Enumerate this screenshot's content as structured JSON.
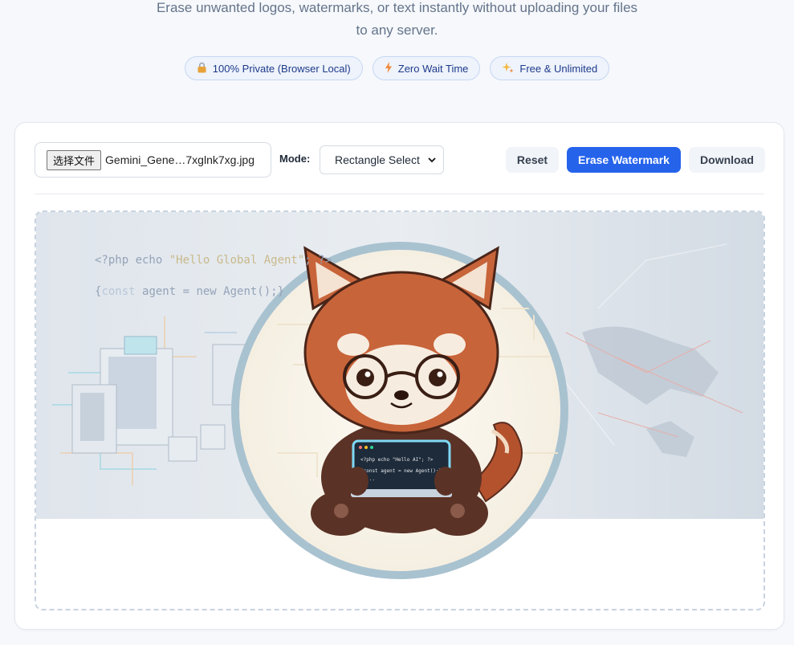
{
  "hero": {
    "subtitle_line1": "Erase unwanted logos, watermarks, or text instantly without uploading your files",
    "subtitle_line2": "to any server."
  },
  "badges": [
    {
      "icon": "lock-icon",
      "label": "100% Private (Browser Local)"
    },
    {
      "icon": "lightning-icon",
      "label": "Zero Wait Time"
    },
    {
      "icon": "sparkles-icon",
      "label": "Free & Unlimited"
    }
  ],
  "toolbar": {
    "file_button_label": "选择文件",
    "file_name": "Gemini_Gene…7xglnk7xg.jpg",
    "mode_label": "Mode:",
    "mode_value": "Rectangle Select",
    "reset_label": "Reset",
    "erase_label": "Erase Watermark",
    "download_label": "Download"
  },
  "image": {
    "code_line1_a": "<?php echo ",
    "code_line1_b": "\"Hello Global Agent\"",
    "code_line1_c": "; ?>",
    "code_line2_a": "{",
    "code_line2_b": "const",
    "code_line2_c": " agent = new Agent();}",
    "laptop_line1": "<?php echo \"Hello AI\"; ?>",
    "laptop_line2": "{const agent = new Agent();}",
    "laptop_line3": "} ..."
  },
  "colors": {
    "primary": "#2563eb",
    "badge_bg": "#eef3fc",
    "badge_border": "#c7d7f3",
    "panda_fur": "#c8643a",
    "ring": "#a9c2d0"
  }
}
